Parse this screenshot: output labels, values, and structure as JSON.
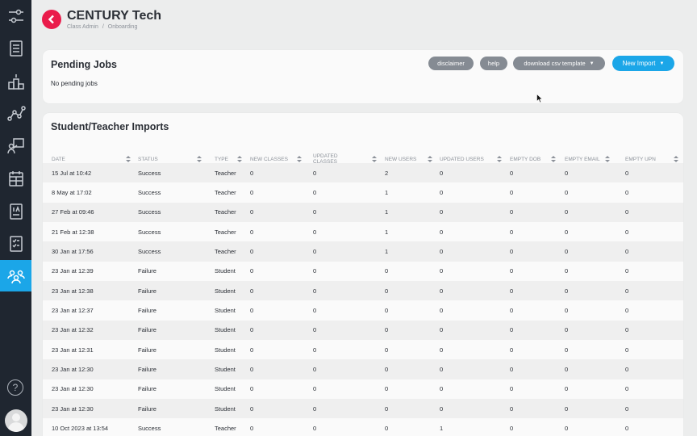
{
  "header": {
    "title": "CENTURY Tech",
    "breadcrumb": [
      "Class Admin",
      "Onboarding"
    ],
    "breadcrumb_sep": "/"
  },
  "sidebar": {
    "icons": [
      "sliders-icon",
      "notebook-icon",
      "podium-icon",
      "nodes-icon",
      "teacher-board-icon",
      "calendar-icon",
      "assessment-icon",
      "checklist-icon",
      "users-group-icon"
    ],
    "active": "users-group-icon",
    "help_label": "?"
  },
  "pending": {
    "title": "Pending Jobs",
    "empty_message": "No pending jobs",
    "buttons": {
      "disclaimer": "disclaimer",
      "help": "help",
      "download": "download csv template",
      "new_import": "New Import"
    }
  },
  "imports": {
    "title": "Student/Teacher Imports",
    "columns": [
      "Date",
      "Status",
      "Type",
      "New Classes",
      "Updated Classes",
      "New Users",
      "Updated Users",
      "Empty DOB",
      "Empty Email",
      "Empty UPN"
    ],
    "rows": [
      [
        "15 Jul at 10:42",
        "Success",
        "Teacher",
        "0",
        "0",
        "2",
        "0",
        "0",
        "0",
        "0"
      ],
      [
        "8 May at 17:02",
        "Success",
        "Teacher",
        "0",
        "0",
        "1",
        "0",
        "0",
        "0",
        "0"
      ],
      [
        "27 Feb at 09:46",
        "Success",
        "Teacher",
        "0",
        "0",
        "1",
        "0",
        "0",
        "0",
        "0"
      ],
      [
        "21 Feb at 12:38",
        "Success",
        "Teacher",
        "0",
        "0",
        "1",
        "0",
        "0",
        "0",
        "0"
      ],
      [
        "30 Jan at 17:56",
        "Success",
        "Teacher",
        "0",
        "0",
        "1",
        "0",
        "0",
        "0",
        "0"
      ],
      [
        "23 Jan at 12:39",
        "Failure",
        "Student",
        "0",
        "0",
        "0",
        "0",
        "0",
        "0",
        "0"
      ],
      [
        "23 Jan at 12:38",
        "Failure",
        "Student",
        "0",
        "0",
        "0",
        "0",
        "0",
        "0",
        "0"
      ],
      [
        "23 Jan at 12:37",
        "Failure",
        "Student",
        "0",
        "0",
        "0",
        "0",
        "0",
        "0",
        "0"
      ],
      [
        "23 Jan at 12:32",
        "Failure",
        "Student",
        "0",
        "0",
        "0",
        "0",
        "0",
        "0",
        "0"
      ],
      [
        "23 Jan at 12:31",
        "Failure",
        "Student",
        "0",
        "0",
        "0",
        "0",
        "0",
        "0",
        "0"
      ],
      [
        "23 Jan at 12:30",
        "Failure",
        "Student",
        "0",
        "0",
        "0",
        "0",
        "0",
        "0",
        "0"
      ],
      [
        "23 Jan at 12:30",
        "Failure",
        "Student",
        "0",
        "0",
        "0",
        "0",
        "0",
        "0",
        "0"
      ],
      [
        "23 Jan at 12:30",
        "Failure",
        "Student",
        "0",
        "0",
        "0",
        "0",
        "0",
        "0",
        "0"
      ],
      [
        "10 Oct 2023 at 13:54",
        "Success",
        "Teacher",
        "0",
        "0",
        "0",
        "1",
        "0",
        "0",
        "0"
      ]
    ]
  },
  "colors": {
    "sidebar_bg": "#1f2630",
    "accent": "#1ba6e8",
    "back_button": "#ea1c4b",
    "pill_grey": "#858b93"
  }
}
